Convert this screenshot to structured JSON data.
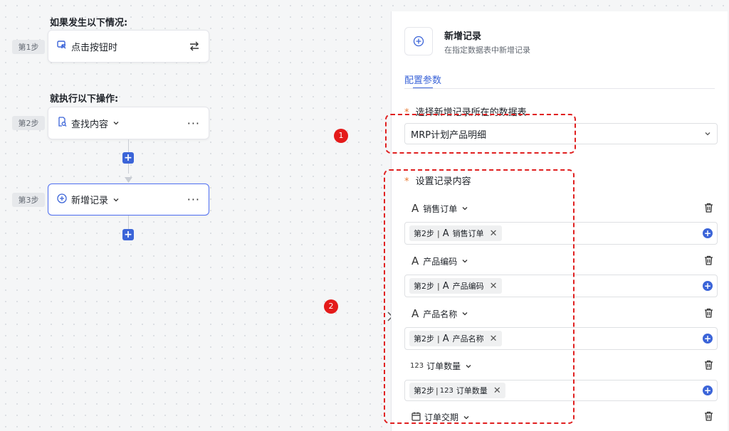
{
  "trigger": {
    "section_title": "如果发生以下情况:",
    "step_label": "第1步",
    "card_label": "点击按钮时"
  },
  "actions": {
    "section_title": "就执行以下操作:",
    "steps": [
      {
        "step_label": "第2步",
        "card_label": "查找内容"
      },
      {
        "step_label": "第3步",
        "card_label": "新增记录"
      }
    ],
    "add_symbol": "+"
  },
  "panel": {
    "title": "新增记录",
    "subtitle": "在指定数据表中新增记录",
    "tab_label": "配置参数",
    "table_field": {
      "required_mark": "*",
      "label": "选择新增记录所在的数据表",
      "value": "MRP计划产品明细"
    },
    "record_content": {
      "required_mark": "*",
      "label": "设置记录内容",
      "fields": [
        {
          "type_icon": "A",
          "name": "销售订单",
          "chip_step": "第2步",
          "chip_sep": "|",
          "chip_icon": "A",
          "chip_name": "销售订单"
        },
        {
          "type_icon": "A",
          "name": "产品编码",
          "chip_step": "第2步",
          "chip_sep": "|",
          "chip_icon": "A",
          "chip_name": "产品编码"
        },
        {
          "type_icon": "A",
          "name": "产品名称",
          "chip_step": "第2步",
          "chip_sep": "|",
          "chip_icon": "A",
          "chip_name": "产品名称"
        },
        {
          "type_icon": "123",
          "name": "订单数量",
          "chip_step": "第2步",
          "chip_sep": "|",
          "chip_icon": "123",
          "chip_name": "订单数量"
        }
      ],
      "last_field": {
        "name": "订单交期"
      }
    }
  },
  "annotations": {
    "marker_1": "1",
    "marker_2": "2"
  },
  "colors": {
    "accent": "#3b64d8",
    "annotation_red": "#e41a1a",
    "required": "#e8772e"
  }
}
